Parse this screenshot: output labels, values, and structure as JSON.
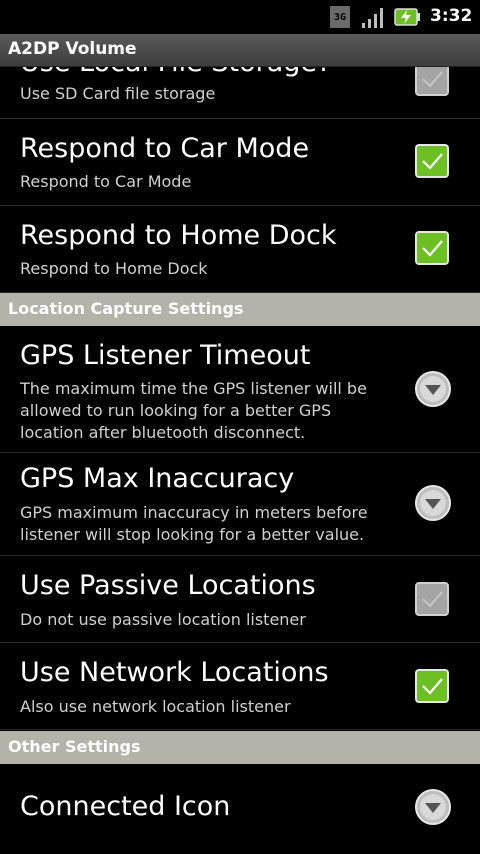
{
  "status_bar": {
    "network_type": "3G",
    "time": "3:32",
    "icons": [
      "3g-icon",
      "signal-icon",
      "battery-charging-icon"
    ]
  },
  "app_title": "A2DP Volume",
  "rows": {
    "local_storage": {
      "title": "Use Local File Storage?",
      "summary": "Use SD Card file storage",
      "control": "checkbox",
      "checked": false
    },
    "car_mode": {
      "title": "Respond to Car Mode",
      "summary": "Respond to Car Mode",
      "control": "checkbox",
      "checked": true
    },
    "home_dock": {
      "title": "Respond to Home Dock",
      "summary": "Respond to Home Dock",
      "control": "checkbox",
      "checked": true
    },
    "gps_timeout": {
      "title": "GPS Listener Timeout",
      "summary": "The maximum time the GPS listener will be allowed to run looking for a better GPS location after bluetooth disconnect.",
      "control": "dropdown"
    },
    "gps_inaccuracy": {
      "title": "GPS Max Inaccuracy",
      "summary": "GPS maximum inaccuracy in meters before listener will stop looking for a better value.",
      "control": "dropdown"
    },
    "passive_locations": {
      "title": "Use Passive Locations",
      "summary": "Do not use passive location listener",
      "control": "checkbox",
      "checked": false
    },
    "network_locations": {
      "title": "Use Network Locations",
      "summary": "Also use network location listener",
      "control": "checkbox",
      "checked": true
    },
    "connected_icon": {
      "title": "Connected Icon",
      "control": "dropdown"
    }
  },
  "sections": {
    "location": "Location Capture Settings",
    "other": "Other Settings"
  },
  "colors": {
    "checkbox_on": "#6cc024",
    "checkbox_off": "#a5a5a5",
    "section_header": "#b3b3aa",
    "title_bar": "#4a4a4a"
  }
}
